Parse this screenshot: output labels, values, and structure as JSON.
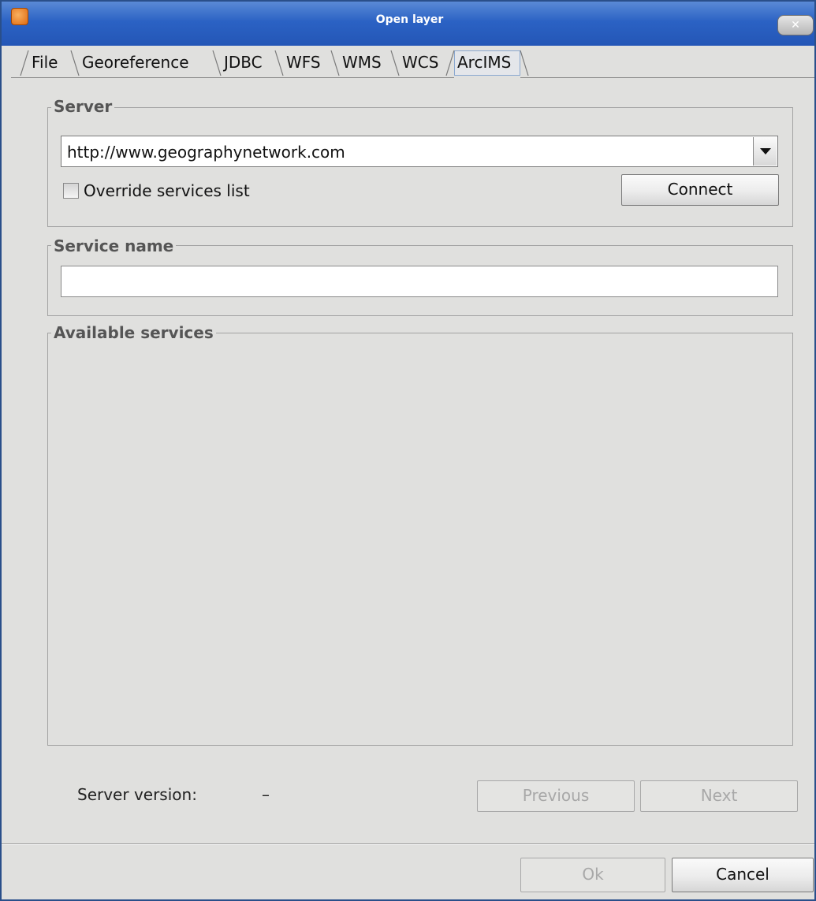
{
  "window": {
    "title": "Open layer",
    "close_glyph": "✕"
  },
  "tabs": [
    {
      "label": "File"
    },
    {
      "label": "Georeference"
    },
    {
      "label": "JDBC"
    },
    {
      "label": "WFS"
    },
    {
      "label": "WMS"
    },
    {
      "label": "WCS"
    },
    {
      "label": "ArcIMS",
      "selected": true
    }
  ],
  "server_group": {
    "title": "Server",
    "url_value": "http://www.geographynetwork.com",
    "override_label": "Override services list",
    "override_checked": false,
    "connect_label": "Connect"
  },
  "service_name_group": {
    "title": "Service name",
    "value": ""
  },
  "available_services_group": {
    "title": "Available services"
  },
  "status": {
    "server_version_label": "Server version:",
    "server_version_value": "–"
  },
  "navigation": {
    "previous_label": "Previous",
    "next_label": "Next"
  },
  "footer": {
    "ok_label": "Ok",
    "cancel_label": "Cancel"
  },
  "icons": {
    "app": "gvsig-app-icon",
    "close": "close-icon",
    "dropdown": "chevron-down-icon"
  }
}
